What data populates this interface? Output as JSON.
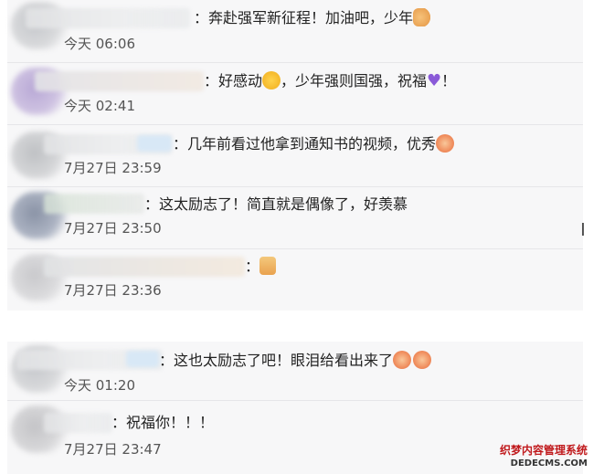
{
  "comments_top": [
    {
      "text": "：奔赴强军新征程！加油吧，少年",
      "emoji": "muscle-emoji",
      "time": "今天 06:06"
    },
    {
      "text_before": "：好感动",
      "emoji": "crying-face-emoji",
      "text_after": "，少年强则国强，祝福",
      "emoji2": "purple-heart-emoji",
      "heart_glyph": "♥",
      "text_end": "！",
      "time": "今天 02:41"
    },
    {
      "text": "：几年前看过他拿到通知书的视频，优秀",
      "emoji": "clapping-emoji",
      "time": "7月27日 23:59"
    },
    {
      "text": "：这太励志了！简直就是偶像了，好羡慕",
      "time": "7月27日 23:50"
    },
    {
      "text": "：",
      "emoji": "thumbs-up-emoji",
      "time": "7月27日 23:36"
    }
  ],
  "comments_bottom": [
    {
      "text": "：这也太励志了吧！眼泪给看出来了",
      "emoji": "clapping-emoji",
      "time": "今天 01:20"
    },
    {
      "text": "：祝福你！！！",
      "time": "7月27日 23:47"
    }
  ],
  "watermark": {
    "cn": "织梦内容管理系统",
    "en": "DEDECMS.COM",
    "color": "#c0191c"
  },
  "colors": {
    "panel": "#f7f7f8",
    "divider": "#e6e6e9",
    "heart": "#8a5ad8"
  }
}
